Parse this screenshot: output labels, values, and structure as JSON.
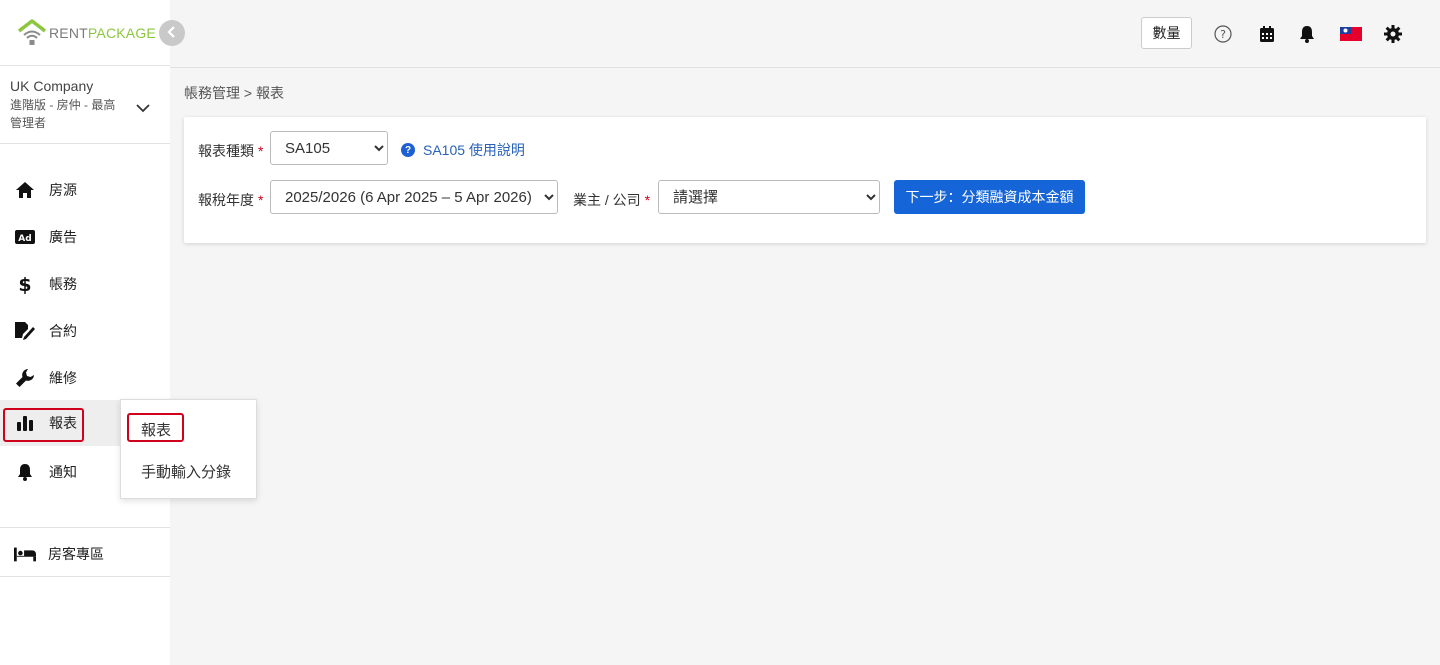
{
  "brand": {
    "logo_rent": "RENT",
    "logo_package": "PACKAGE",
    "collapse_icon": "chevron-left-icon"
  },
  "account": {
    "company": "UK Company",
    "plan": "進階版 - 房仲 - 最高管理者"
  },
  "sidebar": {
    "items": [
      {
        "label": "房源",
        "icon": "home-icon"
      },
      {
        "label": "廣告",
        "icon": "ad-icon"
      },
      {
        "label": "帳務",
        "icon": "dollar-icon"
      },
      {
        "label": "合約",
        "icon": "contract-icon"
      },
      {
        "label": "維修",
        "icon": "wrench-icon"
      },
      {
        "label": "報表",
        "icon": "chart-icon"
      },
      {
        "label": "通知",
        "icon": "bell-icon"
      }
    ],
    "tenant_zone": {
      "label": "房客專區",
      "icon": "bed-icon"
    }
  },
  "submenu": {
    "items": [
      "報表",
      "手動輸入分錄"
    ]
  },
  "header": {
    "qty_label": "數量",
    "icons": [
      "help-icon",
      "calendar-icon",
      "bell-icon",
      "taiwan-flag-icon",
      "gear-icon"
    ]
  },
  "breadcrumb": "帳務管理 > 報表",
  "form": {
    "report_type_label": "報表種類",
    "report_type_value": "SA105",
    "help_link": "SA105 使用說明",
    "tax_year_label": "報稅年度",
    "tax_year_value": "2025/2026 (6 Apr 2025 – 5 Apr 2026)",
    "owner_label": "業主 / 公司",
    "owner_placeholder": "請選擇",
    "required_mark": "*",
    "next_button": "下一步：分類融資成本金額"
  },
  "colors": {
    "primary": "#1565d8",
    "brand_green": "#8cc63f",
    "highlight_red": "#d0021b"
  }
}
